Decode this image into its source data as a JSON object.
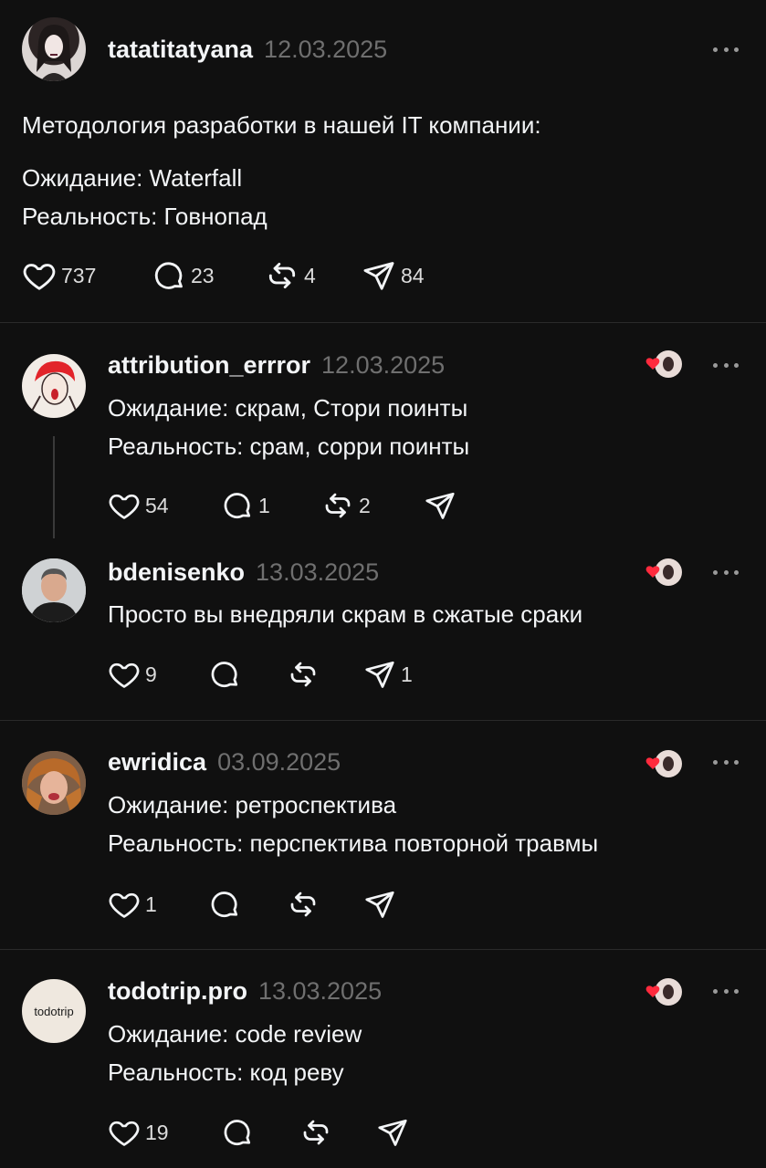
{
  "main_post": {
    "username": "tatatitatyana",
    "date": "12.03.2025",
    "lines": [
      "Методология разработки в нашей IT компании:",
      "Ожидание: Waterfall",
      "Реальность: Говнопад"
    ],
    "likes": "737",
    "comments": "23",
    "reposts": "4",
    "shares": "84"
  },
  "replies": [
    {
      "username": "attribution_errror",
      "date": "12.03.2025",
      "lines": [
        "Ожидание: скрам, Стори поинты",
        "Реальность: срам, сорри поинты"
      ],
      "likes": "54",
      "comments": "1",
      "reposts": "2",
      "shares": ""
    },
    {
      "username": "bdenisenko",
      "date": "13.03.2025",
      "lines": [
        "Просто вы внедряли скрам в сжатые сраки"
      ],
      "likes": "9",
      "comments": "",
      "reposts": "",
      "shares": "1"
    },
    {
      "username": "ewridica",
      "date": "03.09.2025",
      "lines": [
        "Ожидание: ретроспектива",
        "Реальность: перспектива повторной травмы"
      ],
      "likes": "1",
      "comments": "",
      "reposts": "",
      "shares": ""
    },
    {
      "username": "todotrip.pro",
      "date": "13.03.2025",
      "avatar_text": "todotrip",
      "lines": [
        "Ожидание: code review",
        "Реальность: код реву"
      ],
      "likes": "19",
      "comments": "",
      "reposts": "",
      "shares": ""
    }
  ],
  "colors": {
    "background": "#101010",
    "text": "#f3f5f7",
    "muted": "#6f6f6f",
    "like_red": "#ff2a3d"
  }
}
